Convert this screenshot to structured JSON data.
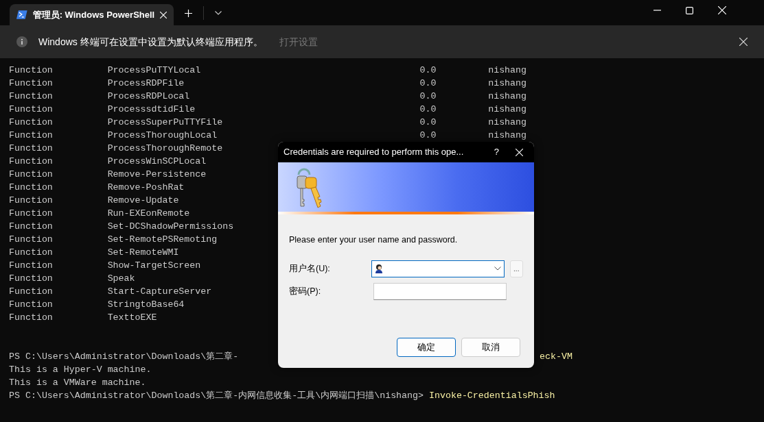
{
  "window": {
    "tab_title": "管理员: Windows PowerShell"
  },
  "infobar": {
    "message": "Windows 终端可在设置中设置为默认终端应用程序。",
    "action": "打开设置"
  },
  "terminal": {
    "rows": [
      {
        "type": "Function",
        "name": "ProcessPuTTYLocal",
        "version": "0.0",
        "source": "nishang"
      },
      {
        "type": "Function",
        "name": "ProcessRDPFile",
        "version": "0.0",
        "source": "nishang"
      },
      {
        "type": "Function",
        "name": "ProcessRDPLocal",
        "version": "0.0",
        "source": "nishang"
      },
      {
        "type": "Function",
        "name": "ProcesssdtidFile",
        "version": "0.0",
        "source": "nishang"
      },
      {
        "type": "Function",
        "name": "ProcessSuperPuTTYFile",
        "version": "0.0",
        "source": "nishang"
      },
      {
        "type": "Function",
        "name": "ProcessThoroughLocal",
        "version": "0.0",
        "source": "nishang"
      },
      {
        "type": "Function",
        "name": "ProcessThoroughRemote"
      },
      {
        "type": "Function",
        "name": "ProcessWinSCPLocal"
      },
      {
        "type": "Function",
        "name": "Remove-Persistence"
      },
      {
        "type": "Function",
        "name": "Remove-PoshRat"
      },
      {
        "type": "Function",
        "name": "Remove-Update"
      },
      {
        "type": "Function",
        "name": "Run-EXEonRemote"
      },
      {
        "type": "Function",
        "name": "Set-DCShadowPermissions"
      },
      {
        "type": "Function",
        "name": "Set-RemotePSRemoting"
      },
      {
        "type": "Function",
        "name": "Set-RemoteWMI"
      },
      {
        "type": "Function",
        "name": "Show-TargetScreen"
      },
      {
        "type": "Function",
        "name": "Speak"
      },
      {
        "type": "Function",
        "name": "Start-CaptureServer"
      },
      {
        "type": "Function",
        "name": "StringtoBase64"
      },
      {
        "type": "Function",
        "name": "TexttoEXE"
      }
    ],
    "lines": [
      {
        "kind": "prompt",
        "prompt": "PS C:\\Users\\Administrator\\Downloads\\第二章-",
        "command": "eck-VM",
        "gap": true
      },
      {
        "kind": "output",
        "text": "This is a Hyper-V machine."
      },
      {
        "kind": "output",
        "text": "This is a VMWare machine."
      },
      {
        "kind": "prompt",
        "prompt": "PS C:\\Users\\Administrator\\Downloads\\第二章-内网信息收集-工具\\内网端口扫描\\nishang>",
        "command": "Invoke-CredentialsPhish",
        "gap": false
      }
    ]
  },
  "dialog": {
    "title": "Credentials are required to perform this ope...",
    "help": "?",
    "message": "Please enter your user name and password.",
    "username_label": "用户名(U):",
    "password_label": "密码(P):",
    "browse": "...",
    "buttons": [
      {
        "label": "确定",
        "default": true
      },
      {
        "label": "取消",
        "default": false
      }
    ]
  }
}
